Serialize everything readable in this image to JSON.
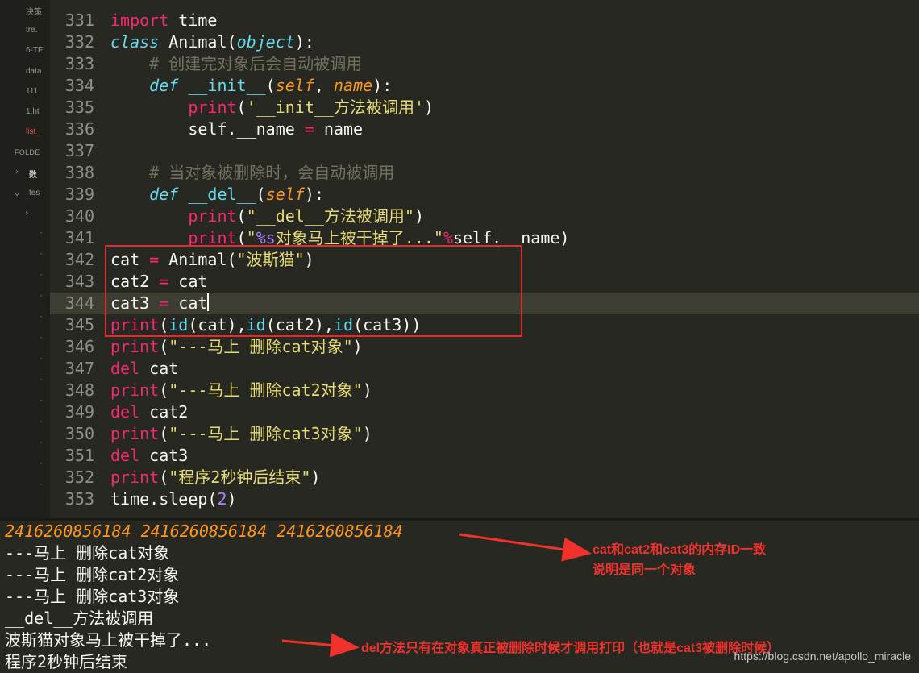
{
  "sidebar": {
    "files": [
      "决策",
      "tre.",
      "6-TF",
      "data",
      "111",
      "1.ht",
      "list_"
    ],
    "folders_label": "FOLDE",
    "folder_items": [
      "数",
      "tes"
    ]
  },
  "editor": {
    "lines": [
      {
        "num": "331",
        "tokens": [
          {
            "t": "import",
            "c": "kw"
          },
          {
            "t": " time",
            "c": ""
          }
        ]
      },
      {
        "num": "332",
        "tokens": [
          {
            "t": "class",
            "c": "it"
          },
          {
            "t": " ",
            "c": ""
          },
          {
            "t": "Animal",
            "c": ""
          },
          {
            "t": "(",
            "c": ""
          },
          {
            "t": "object",
            "c": "it"
          },
          {
            "t": "):",
            "c": ""
          }
        ]
      },
      {
        "num": "333",
        "tokens": [
          {
            "t": "    # 创建完对象后会自动被调用",
            "c": "cm"
          }
        ]
      },
      {
        "num": "334",
        "tokens": [
          {
            "t": "    ",
            "c": ""
          },
          {
            "t": "def",
            "c": "it"
          },
          {
            "t": " ",
            "c": ""
          },
          {
            "t": "__init__",
            "c": "bi"
          },
          {
            "t": "(",
            "c": ""
          },
          {
            "t": "self",
            "c": "pm"
          },
          {
            "t": ", ",
            "c": ""
          },
          {
            "t": "name",
            "c": "pm"
          },
          {
            "t": "):",
            "c": ""
          }
        ]
      },
      {
        "num": "335",
        "tokens": [
          {
            "t": "        ",
            "c": ""
          },
          {
            "t": "print",
            "c": "kw"
          },
          {
            "t": "(",
            "c": ""
          },
          {
            "t": "'__init__方法被调用'",
            "c": "st"
          },
          {
            "t": ")",
            "c": ""
          }
        ]
      },
      {
        "num": "336",
        "tokens": [
          {
            "t": "        self.__name ",
            "c": ""
          },
          {
            "t": "=",
            "c": "kw"
          },
          {
            "t": " name",
            "c": ""
          }
        ]
      },
      {
        "num": "337",
        "tokens": []
      },
      {
        "num": "338",
        "tokens": [
          {
            "t": "    # 当对象被删除时，会自动被调用",
            "c": "cm"
          }
        ]
      },
      {
        "num": "339",
        "tokens": [
          {
            "t": "    ",
            "c": ""
          },
          {
            "t": "def",
            "c": "it"
          },
          {
            "t": " ",
            "c": ""
          },
          {
            "t": "__del__",
            "c": "bi"
          },
          {
            "t": "(",
            "c": ""
          },
          {
            "t": "self",
            "c": "pm"
          },
          {
            "t": "):",
            "c": ""
          }
        ]
      },
      {
        "num": "340",
        "tokens": [
          {
            "t": "        ",
            "c": ""
          },
          {
            "t": "print",
            "c": "kw"
          },
          {
            "t": "(",
            "c": ""
          },
          {
            "t": "\"__del__方法被调用\"",
            "c": "st"
          },
          {
            "t": ")",
            "c": ""
          }
        ]
      },
      {
        "num": "341",
        "tokens": [
          {
            "t": "        ",
            "c": ""
          },
          {
            "t": "print",
            "c": "kw"
          },
          {
            "t": "(",
            "c": ""
          },
          {
            "t": "\"",
            "c": "st"
          },
          {
            "t": "%s",
            "c": "nu"
          },
          {
            "t": "对象马上被干掉了...\"",
            "c": "st"
          },
          {
            "t": "%",
            "c": "kw"
          },
          {
            "t": "self.__name)",
            "c": ""
          }
        ]
      },
      {
        "num": "342",
        "tokens": [
          {
            "t": "cat ",
            "c": ""
          },
          {
            "t": "=",
            "c": "kw"
          },
          {
            "t": " Animal(",
            "c": ""
          },
          {
            "t": "\"波斯猫\"",
            "c": "st"
          },
          {
            "t": ")",
            "c": ""
          }
        ]
      },
      {
        "num": "343",
        "tokens": [
          {
            "t": "cat2 ",
            "c": ""
          },
          {
            "t": "=",
            "c": "kw"
          },
          {
            "t": " cat",
            "c": ""
          }
        ]
      },
      {
        "num": "344",
        "tokens": [
          {
            "t": "cat3 ",
            "c": ""
          },
          {
            "t": "=",
            "c": "kw"
          },
          {
            "t": " cat",
            "c": ""
          }
        ],
        "active": true
      },
      {
        "num": "345",
        "tokens": [
          {
            "t": "print",
            "c": "kw"
          },
          {
            "t": "(",
            "c": ""
          },
          {
            "t": "id",
            "c": "bi"
          },
          {
            "t": "(cat),",
            "c": ""
          },
          {
            "t": "id",
            "c": "bi"
          },
          {
            "t": "(cat2),",
            "c": ""
          },
          {
            "t": "id",
            "c": "bi"
          },
          {
            "t": "(cat3))",
            "c": ""
          }
        ]
      },
      {
        "num": "346",
        "tokens": [
          {
            "t": "print",
            "c": "kw"
          },
          {
            "t": "(",
            "c": ""
          },
          {
            "t": "\"---马上 删除cat对象\"",
            "c": "st"
          },
          {
            "t": ")",
            "c": ""
          }
        ]
      },
      {
        "num": "347",
        "tokens": [
          {
            "t": "del",
            "c": "kw"
          },
          {
            "t": " cat",
            "c": ""
          }
        ]
      },
      {
        "num": "348",
        "tokens": [
          {
            "t": "print",
            "c": "kw"
          },
          {
            "t": "(",
            "c": ""
          },
          {
            "t": "\"---马上 删除cat2对象\"",
            "c": "st"
          },
          {
            "t": ")",
            "c": ""
          }
        ]
      },
      {
        "num": "349",
        "tokens": [
          {
            "t": "del",
            "c": "kw"
          },
          {
            "t": " cat2",
            "c": ""
          }
        ]
      },
      {
        "num": "350",
        "tokens": [
          {
            "t": "print",
            "c": "kw"
          },
          {
            "t": "(",
            "c": ""
          },
          {
            "t": "\"---马上 删除cat3对象\"",
            "c": "st"
          },
          {
            "t": ")",
            "c": ""
          }
        ]
      },
      {
        "num": "351",
        "tokens": [
          {
            "t": "del",
            "c": "kw"
          },
          {
            "t": " cat3",
            "c": ""
          }
        ]
      },
      {
        "num": "352",
        "tokens": [
          {
            "t": "print",
            "c": "kw"
          },
          {
            "t": "(",
            "c": ""
          },
          {
            "t": "\"程序2秒钟后结束\"",
            "c": "st"
          },
          {
            "t": ")",
            "c": ""
          }
        ]
      },
      {
        "num": "353",
        "tokens": [
          {
            "t": "time.sleep(",
            "c": ""
          },
          {
            "t": "2",
            "c": "nu"
          },
          {
            "t": ")",
            "c": ""
          }
        ]
      }
    ]
  },
  "console": {
    "ids": [
      "2416260856184",
      "2416260856184",
      "2416260856184"
    ],
    "lines": [
      "---马上 删除cat对象",
      "---马上 删除cat2对象",
      "---马上 删除cat3对象",
      "__del__方法被调用",
      "波斯猫对象马上被干掉了...",
      "程序2秒钟后结束"
    ]
  },
  "annotations": {
    "id_note_line1": "cat和cat2和cat3的内存ID一致",
    "id_note_line2": "说明是同一个对象",
    "del_note": "del方法只有在对象真正被删除时候才调用打印（也就是cat3被删除时候）"
  },
  "watermark": "https://blog.csdn.net/apollo_miracle",
  "colors": {
    "background": "#272822",
    "keyword": "#f92672",
    "builtin": "#66d9ef",
    "string": "#e6db74",
    "comment": "#75715e",
    "param": "#fd971f",
    "annotation": "#f0312c"
  }
}
